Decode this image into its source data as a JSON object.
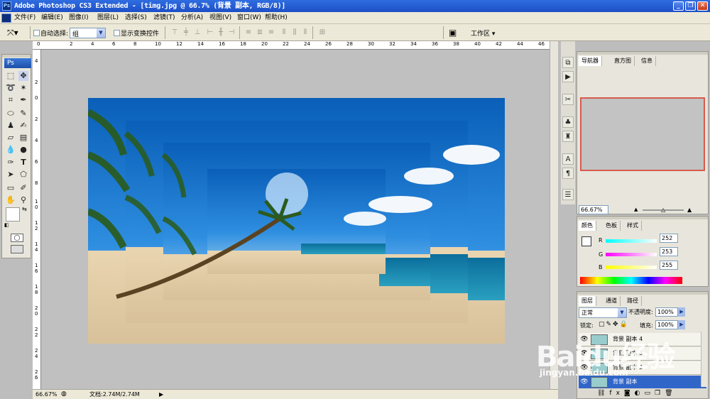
{
  "window": {
    "title": "Adobe Photoshop CS3 Extended - [timg.jpg @ 66.7% (背景 副本, RGB/8)]",
    "ps": "Ps"
  },
  "menu": [
    "文件(F)",
    "编辑(E)",
    "图像(I)",
    "图层(L)",
    "选择(S)",
    "滤镜(T)",
    "分析(A)",
    "视图(V)",
    "窗口(W)",
    "帮助(H)"
  ],
  "options": {
    "auto_select": "自动选择:",
    "group_value": "组",
    "show_transform": "显示变换控件",
    "workspace": "工作区 ▾"
  },
  "toolbox": {
    "logo": "Ps"
  },
  "ruler": {
    "h": [
      "0",
      "2",
      "4",
      "6",
      "8",
      "10",
      "12",
      "14",
      "16",
      "18",
      "20",
      "22",
      "24",
      "26",
      "28",
      "30",
      "32",
      "34",
      "36",
      "38",
      "40",
      "42",
      "44",
      "46"
    ],
    "v": [
      "4",
      "2",
      "0",
      "2",
      "4",
      "6",
      "8",
      "1",
      "0",
      "1",
      "2",
      "1",
      "4",
      "1",
      "6",
      "1",
      "8",
      "2",
      "0",
      "2",
      "2",
      "2",
      "4",
      "2",
      "6"
    ]
  },
  "status": {
    "zoom": "66.67%",
    "doc": "文档:2.74M/2.74M"
  },
  "navigator": {
    "tabs": [
      "导航器",
      "直方图",
      "信息"
    ],
    "zoom": "66.67%"
  },
  "color": {
    "tabs": [
      "颜色",
      "色板",
      "样式"
    ],
    "r_label": "R",
    "g_label": "G",
    "b_label": "B",
    "r": "252",
    "g": "253",
    "b": "255"
  },
  "layers": {
    "tabs": [
      "图层",
      "通道",
      "路径"
    ],
    "blend": "正常",
    "opacity_label": "不透明度:",
    "opacity": "100%",
    "lock_label": "锁定:",
    "fill_label": "填充:",
    "fill": "100%",
    "items": [
      "背景 副本 4",
      "背景 副本 3",
      "背景 副本 2",
      "背景 副本"
    ]
  },
  "watermark": {
    "brand": "Baidu经验",
    "url": "jingyan.baidu.com"
  }
}
